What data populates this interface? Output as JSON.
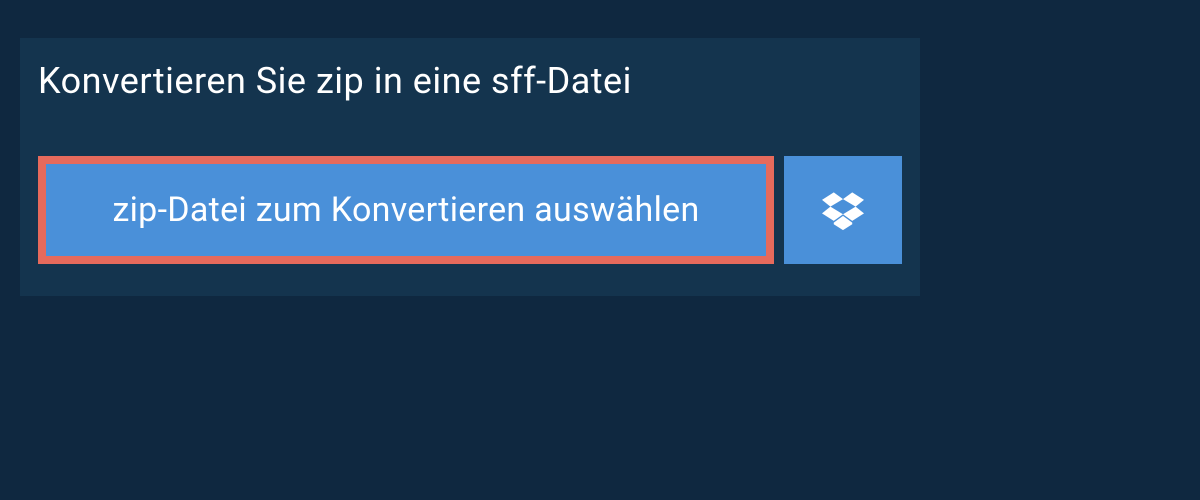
{
  "header": {
    "title": "Konvertieren Sie zip in eine sff-Datei"
  },
  "actions": {
    "select_file_label": "zip-Datei zum Konvertieren auswählen"
  },
  "colors": {
    "background": "#0f2840",
    "panel": "#14344e",
    "button": "#4a90d9",
    "button_border": "#e66a5c"
  }
}
